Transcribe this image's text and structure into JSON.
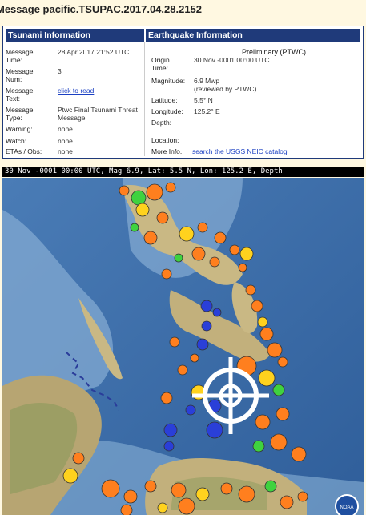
{
  "page": {
    "title": "Message pacific.TSUPAC.2017.04.28.2152"
  },
  "tsunami": {
    "header": "Tsunami Information",
    "rows": [
      {
        "label": "Message Time:",
        "value": "28 Apr 2017 21:52 UTC"
      },
      {
        "label": "Message Num:",
        "value": "3"
      },
      {
        "label": "Message Text:",
        "value": "click to read"
      },
      {
        "label": "Message Type:",
        "value": "Ptwc Final Tsunami Threat Message"
      },
      {
        "label": "Warning:",
        "value": "none"
      },
      {
        "label": "Watch:",
        "value": "none"
      },
      {
        "label": "ETAs / Obs:",
        "value": "none"
      }
    ]
  },
  "earthquake": {
    "header": "Earthquake Information",
    "status": "Preliminary (PTWC)",
    "origin_label": "Origin Time:",
    "origin_value": "30 Nov -0001 00:00 UTC",
    "magnitude_label": "Magnitude:",
    "magnitude_value": "6.9 Mwp",
    "magnitude_note": "(reviewed by PTWC)",
    "latitude_label": "Latitude:",
    "latitude_value": "5.5° N",
    "longitude_label": "Longitude:",
    "longitude_value": "125.2° E",
    "depth_label": "Depth:",
    "depth_value": "",
    "location_label": "Location:",
    "location_value": "",
    "more_label": "More Info.:",
    "more_link": "search the USGS NEIC catalog"
  },
  "map": {
    "caption": "30 Nov -0001 00:00 UTC, Mag 6.9, Lat: 5.5 N, Lon: 125.2 E, Depth",
    "badge": "NOAA",
    "colors": {
      "ocean_deep": "#3f6ea8",
      "ocean_shallow": "#8fb2d6",
      "land": "#cdbb8a",
      "vegetation": "#7a9a52",
      "shallow_quake": "#ff7f1e",
      "mid_quake": "#ffd21e",
      "deep_quake": "#2a3fd8",
      "green_quake": "#3fd23f"
    }
  }
}
